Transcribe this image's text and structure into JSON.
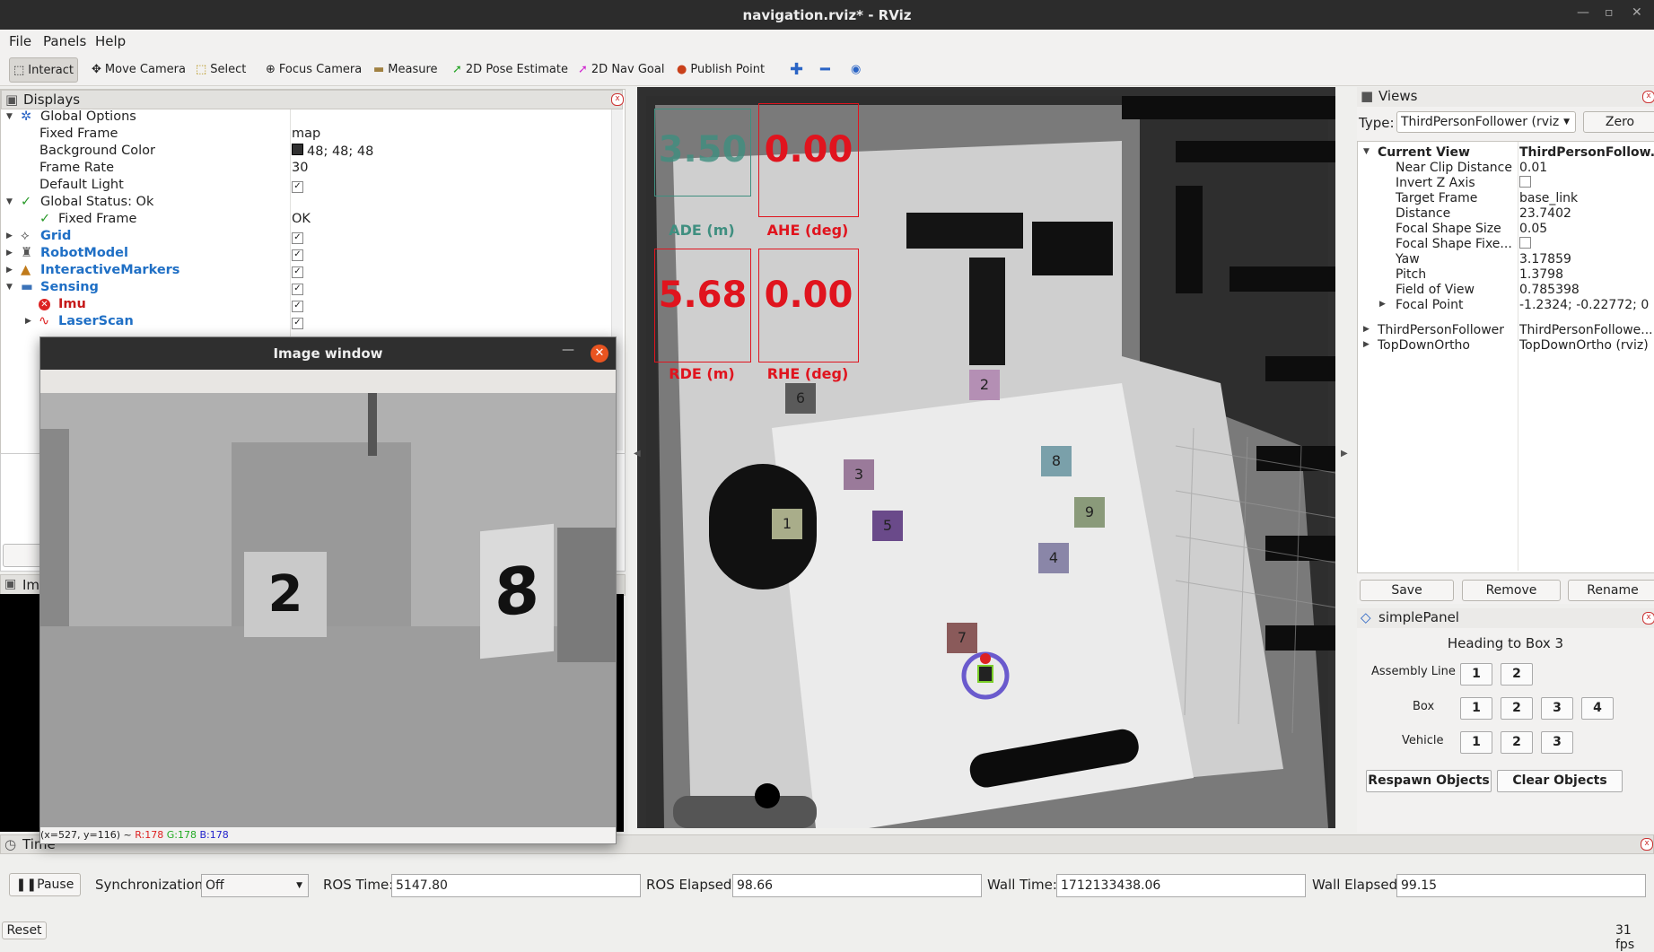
{
  "window": {
    "title": "navigation.rviz* - RViz"
  },
  "menu": [
    "File",
    "Panels",
    "Help"
  ],
  "toolbar": {
    "interact": "Interact",
    "move_camera": "Move Camera",
    "select": "Select",
    "focus_camera": "Focus Camera",
    "measure": "Measure",
    "pose_estimate": "2D Pose Estimate",
    "nav_goal": "2D Nav Goal",
    "publish_point": "Publish Point"
  },
  "displays": {
    "title": "Displays",
    "global_options": "Global Options",
    "fixed_frame_label": "Fixed Frame",
    "fixed_frame_value": "map",
    "background_color_label": "Background Color",
    "background_color_value": "48; 48; 48",
    "frame_rate_label": "Frame Rate",
    "frame_rate_value": "30",
    "default_light_label": "Default Light",
    "global_status": "Global Status: Ok",
    "status_fixed_frame": "Fixed Frame",
    "status_fixed_frame_value": "OK",
    "grid": "Grid",
    "robot_model": "RobotModel",
    "interactive_markers": "InteractiveMarkers",
    "sensing": "Sensing",
    "imu": "Imu",
    "laser_scan": "LaserScan",
    "partial_label": "Ima"
  },
  "image_window": {
    "title": "Image window",
    "status_coord": "(x=527, y=116) ~ ",
    "status_r": "R:178",
    "status_g": "G:178",
    "status_b": "B:178",
    "box_left": "2",
    "box_right": "8"
  },
  "metrics": {
    "ade_value": "3.50",
    "ade_label": "ADE (m)",
    "ahe_value": "0.00",
    "ahe_label": "AHE (deg)",
    "rde_value": "5.68",
    "rde_label": "RDE (m)",
    "rhe_value": "0.00",
    "rhe_label": "RHE (deg)"
  },
  "map_boxes": [
    "6",
    "2",
    "3",
    "8",
    "1",
    "5",
    "9",
    "4",
    "7"
  ],
  "views": {
    "title": "Views",
    "type_label": "Type:",
    "type_value": "ThirdPersonFollower (rviz",
    "zero": "Zero",
    "current_view": "Current View",
    "current_view_value": "ThirdPersonFollow...",
    "props": [
      {
        "name": "Near Clip Distance",
        "value": "0.01"
      },
      {
        "name": "Invert Z Axis",
        "value": ""
      },
      {
        "name": "Target Frame",
        "value": "base_link"
      },
      {
        "name": "Distance",
        "value": "23.7402"
      },
      {
        "name": "Focal Shape Size",
        "value": "0.05"
      },
      {
        "name": "Focal Shape Fixe...",
        "value": ""
      },
      {
        "name": "Yaw",
        "value": "3.17859"
      },
      {
        "name": "Pitch",
        "value": "1.3798"
      },
      {
        "name": "Field of View",
        "value": "0.785398"
      },
      {
        "name": "Focal Point",
        "value": "-1.2324; -0.22772; 0"
      }
    ],
    "saved1": "ThirdPersonFollower",
    "saved1_value": "ThirdPersonFollowe...",
    "saved2": "TopDownOrtho",
    "saved2_value": "TopDownOrtho (rviz)",
    "save": "Save",
    "remove": "Remove",
    "rename": "Rename"
  },
  "simple_panel": {
    "title": "simplePanel",
    "status": "Heading to Box 3",
    "assembly_label": "Assembly Line",
    "assembly": [
      "1",
      "2"
    ],
    "box_label": "Box",
    "box": [
      "1",
      "2",
      "3",
      "4"
    ],
    "vehicle_label": "Vehicle",
    "vehicle": [
      "1",
      "2",
      "3"
    ],
    "respawn": "Respawn Objects",
    "clear": "Clear Objects"
  },
  "time": {
    "title": "Time",
    "pause": "Pause",
    "sync_label": "Synchronization:",
    "sync_value": "Off",
    "ros_time_label": "ROS Time:",
    "ros_time": "5147.80",
    "ros_elapsed_label": "ROS Elapsed:",
    "ros_elapsed": "98.66",
    "wall_time_label": "Wall Time:",
    "wall_time": "1712133438.06",
    "wall_elapsed_label": "Wall Elapsed:",
    "wall_elapsed": "99.15",
    "reset": "Reset",
    "fps": "31 fps"
  },
  "colors": {
    "metric_red": "#e0141e",
    "metric_green": "#3f8f80",
    "accent_blue": "#1f6fc5"
  }
}
